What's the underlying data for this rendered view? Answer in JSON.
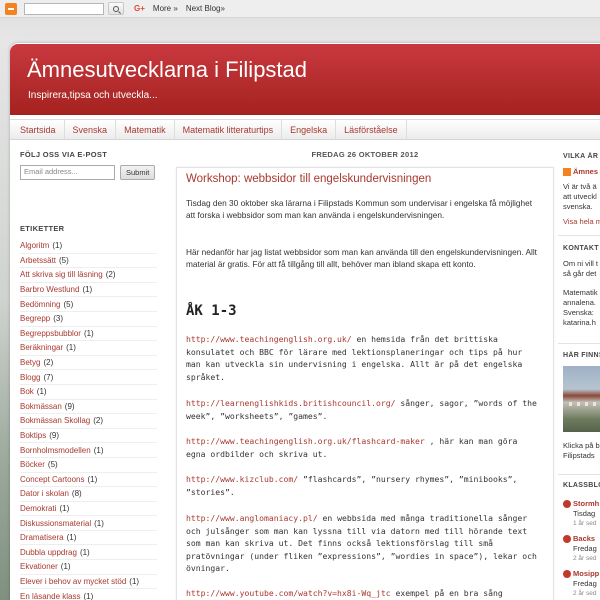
{
  "navbar": {
    "more_label": "More »",
    "next_blog_label": "Next Blog»",
    "gplus_label": "G+"
  },
  "header": {
    "title": "Ämnesutvecklarna i Filipstad",
    "subtitle": "Inspirera,tipsa och utveckla..."
  },
  "tabs": [
    "Startsida",
    "Svenska",
    "Matematik",
    "Matematik litteraturtips",
    "Engelska",
    "Läsförståelse"
  ],
  "sidebar": {
    "follow_heading": "FÖLJ OSS VIA E-POST",
    "email_placeholder": "Email address...",
    "submit_label": "Submit",
    "labels_heading": "ETIKETTER",
    "labels": [
      {
        "name": "Algoritm",
        "count": "(1)"
      },
      {
        "name": "Arbetssätt",
        "count": "(5)"
      },
      {
        "name": "Att skriva sig till läsning",
        "count": "(2)"
      },
      {
        "name": "Barbro Westlund",
        "count": "(1)"
      },
      {
        "name": "Bedömning",
        "count": "(5)"
      },
      {
        "name": "Begrepp",
        "count": "(3)"
      },
      {
        "name": "Begreppsbubblor",
        "count": "(1)"
      },
      {
        "name": "Beräkningar",
        "count": "(1)"
      },
      {
        "name": "Betyg",
        "count": "(2)"
      },
      {
        "name": "Blogg",
        "count": "(7)"
      },
      {
        "name": "Bok",
        "count": "(1)"
      },
      {
        "name": "Bokmässan",
        "count": "(9)"
      },
      {
        "name": "Bokmässan Skollag",
        "count": "(2)"
      },
      {
        "name": "Boktips",
        "count": "(9)"
      },
      {
        "name": "Bornholmsmodellen",
        "count": "(1)"
      },
      {
        "name": "Böcker",
        "count": "(5)"
      },
      {
        "name": "Concept Cartoons",
        "count": "(1)"
      },
      {
        "name": "Dator i skolan",
        "count": "(8)"
      },
      {
        "name": "Demokrati",
        "count": "(1)"
      },
      {
        "name": "Diskussionsmaterial",
        "count": "(1)"
      },
      {
        "name": "Dramatisera",
        "count": "(1)"
      },
      {
        "name": "Dubbla uppdrag",
        "count": "(1)"
      },
      {
        "name": "Ekvationer",
        "count": "(1)"
      },
      {
        "name": "Elever i behov av mycket stöd",
        "count": "(1)"
      },
      {
        "name": "En läsande klass",
        "count": "(1)"
      },
      {
        "name": "Engelska",
        "count": "(20)"
      }
    ]
  },
  "post": {
    "date": "FREDAG 26 OKTOBER 2012",
    "title": "Workshop: webbsidor till engelskundervisningen",
    "intro": "Tisdag den 30 oktober ska lärarna i Filipstads Kommun som undervisar i engelska få möjlighet att forska i webbsidor som man kan använda i engelskundervisningen.",
    "listing": "Här nedanför har jag listat webbsidor som man kan använda till den engelskundervisningen. Allt material är gratis. För att få tillgång till allt, behöver man ibland skapa ett konto.",
    "section_heading": "ÅK 1-3",
    "entries": [
      {
        "url": "http://www.teachingenglish.org.uk/",
        "text": " en hemsida från det brittiska konsulatet och BBC för lärare med lektionsplaneringar och tips på hur man kan utveckla sin undervisning i engelska. Allt är på det engelska språket."
      },
      {
        "url": "http://learnenglishkids.britishcouncil.org/",
        "text": " sånger, sagor, ”words of the week”, ”worksheets”, ”games”."
      },
      {
        "url": "http://www.teachingenglish.org.uk/flashcard-maker",
        "text": " , här kan man göra egna ordbilder och skriva ut."
      },
      {
        "url": "http://www.kizclub.com/",
        "text": " ”flashcards”, ”nursery rhymes”, ”minibooks”, ”stories”."
      },
      {
        "url": "http://www.anglomaniacy.pl/",
        "text": " en webbsida med många traditionella sånger och julsånger som man kan lyssna till via datorn med till hörande text som man kan skriva ut. Det finns också lektionsförslag till små pratövningar (under fliken ”expressions”, ”wordies in space”), lekar och övningar."
      },
      {
        "url": "http://www.youtube.com/watch?v=hx8i-Wq_jtc",
        "text": " exempel på en bra sång"
      }
    ]
  },
  "right_sidebar": {
    "vilka_heading": "VILKA ÄR",
    "vilka_link": "Ämnes",
    "vilka_text": [
      "Vi är två ä",
      "att utveckl",
      "svenska."
    ],
    "vilka_more": "Visa hela m",
    "kontakt_heading": "KONTAKT",
    "kontakt_text": [
      "Om ni vill t",
      "så går det"
    ],
    "kontakt_text2": [
      "Matematik",
      "annalena.",
      "Svenska:",
      "katarina.h"
    ],
    "photo_heading": "HÄR FINNS",
    "photo_caption": [
      "Klicka på b",
      "Filipstads"
    ],
    "klass_heading": "KLASSBLO",
    "blogs": [
      {
        "name": "Stormh",
        "meta": "Tisdag",
        "ago": "1 år sed"
      },
      {
        "name": "Backs",
        "meta": "Fredag",
        "ago": "2 år sed"
      },
      {
        "name": "Mosipp",
        "meta": "Fredag",
        "ago": "2 år sed"
      }
    ]
  },
  "colors": {
    "header_red": "#b22c2b",
    "link_red": "#a83930",
    "navbar_bg": "#eeeeee"
  }
}
